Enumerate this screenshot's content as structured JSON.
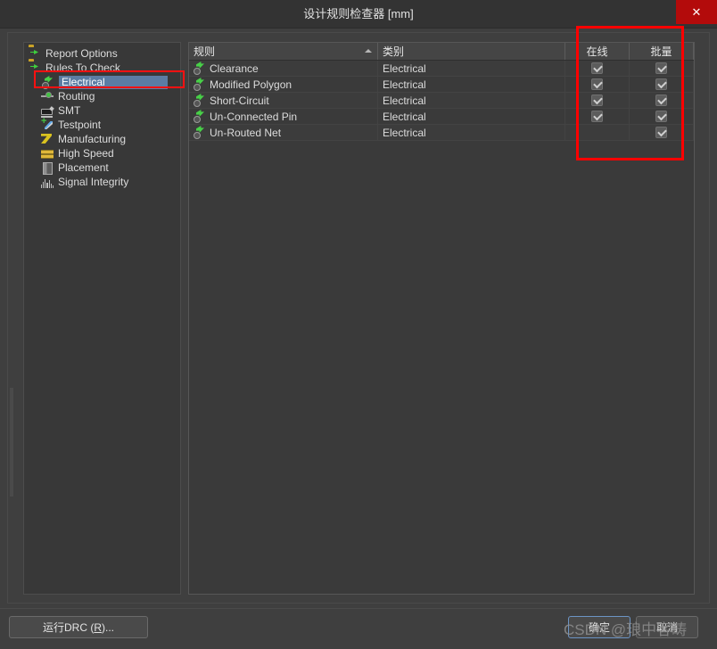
{
  "window": {
    "title": "设计规则检查器 [mm]",
    "close_label": "✕",
    "accent_red": "#b30b0b",
    "annotation_color": "#ff0000",
    "selection_color": "#5b7ca3"
  },
  "tree": {
    "items": [
      {
        "label": "Report Options",
        "icon": "folder-icon",
        "level": 0,
        "selected": false
      },
      {
        "label": "Rules To Check",
        "icon": "folder-icon",
        "level": 0,
        "selected": false
      },
      {
        "label": "Electrical",
        "icon": "electrical-rule-icon",
        "level": 1,
        "selected": true
      },
      {
        "label": "Routing",
        "icon": "routing-icon",
        "level": 1,
        "selected": false
      },
      {
        "label": "SMT",
        "icon": "smt-icon",
        "level": 1,
        "selected": false
      },
      {
        "label": "Testpoint",
        "icon": "testpoint-icon",
        "level": 1,
        "selected": false
      },
      {
        "label": "Manufacturing",
        "icon": "manufacturing-icon",
        "level": 1,
        "selected": false
      },
      {
        "label": "High Speed",
        "icon": "high-speed-icon",
        "level": 1,
        "selected": false
      },
      {
        "label": "Placement",
        "icon": "placement-icon",
        "level": 1,
        "selected": false
      },
      {
        "label": "Signal Integrity",
        "icon": "signal-integrity-icon",
        "level": 1,
        "selected": false
      }
    ]
  },
  "rules_table": {
    "columns": [
      {
        "key": "rule",
        "label": "规则",
        "sorted": "asc"
      },
      {
        "key": "cat",
        "label": "类别",
        "sorted": ""
      },
      {
        "key": "online",
        "label": "在线",
        "sorted": ""
      },
      {
        "key": "batch",
        "label": "批量",
        "sorted": ""
      }
    ],
    "rows": [
      {
        "rule": "Clearance",
        "cat": "Electrical",
        "online": true,
        "batch": true
      },
      {
        "rule": "Modified Polygon",
        "cat": "Electrical",
        "online": true,
        "batch": true
      },
      {
        "rule": "Short-Circuit",
        "cat": "Electrical",
        "online": true,
        "batch": true
      },
      {
        "rule": "Un-Connected Pin",
        "cat": "Electrical",
        "online": true,
        "batch": true
      },
      {
        "rule": "Un-Routed Net",
        "cat": "Electrical",
        "online": false,
        "batch": true
      }
    ]
  },
  "footer": {
    "run_drc_label": "运行DRC (R)...",
    "ok_label": "确定",
    "cancel_label": "取消"
  },
  "watermark": {
    "text": "CSDN @琅中客畴"
  }
}
